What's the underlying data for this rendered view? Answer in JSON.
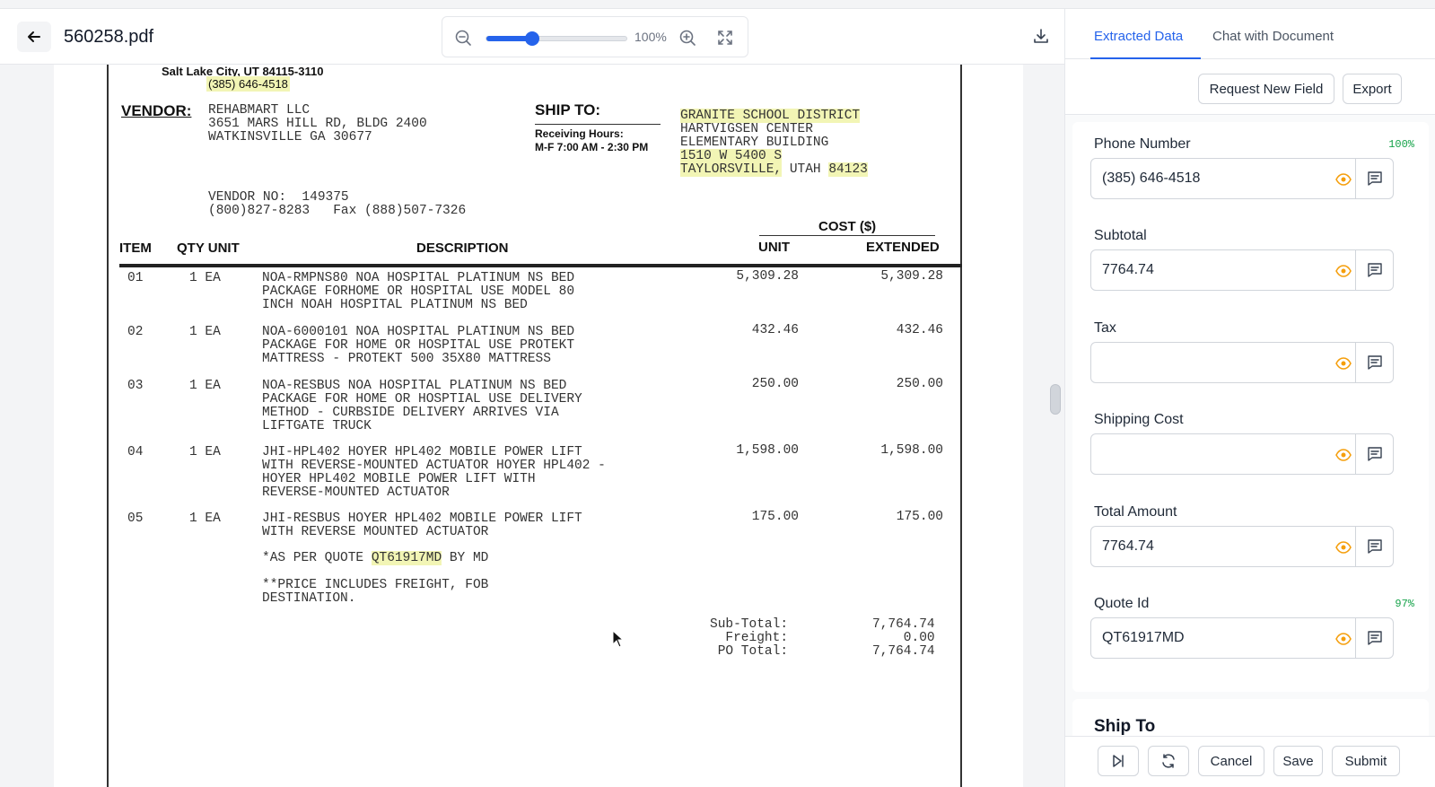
{
  "viewer": {
    "file_name": "560258.pdf",
    "zoom_level": "100%",
    "zoom_fraction": 0.33
  },
  "document": {
    "top_address": "Salt Lake City, UT  84115-3110",
    "top_phone": "(385) 646-4518",
    "vendor_label": "VENDOR:",
    "vendor_lines": [
      "REHABMART LLC",
      "3651 MARS HILL RD, BLDG 2400",
      "WATKINSVILLE GA 30677"
    ],
    "ship_to_label": "SHIP TO:",
    "receiving_label": "Receiving Hours:",
    "receiving_hours": "M-F 7:00 AM - 2:30 PM",
    "ship_lines": [
      "GRANITE SCHOOL DISTRICT",
      "HARTVIGSEN CENTER",
      "ELEMENTARY BUILDING",
      "1510 W 5400 S",
      "TAYLORSVILLE,",
      "UTAH",
      "84123"
    ],
    "vendor_no_line": "VENDOR NO:  149375",
    "vendor_phone_line": "(800)827-8283   Fax (888)507-7326",
    "headers": {
      "cost": "COST ($)",
      "item": "ITEM",
      "qty_unit": "QTY UNIT",
      "description": "DESCRIPTION",
      "unit": "UNIT",
      "extended": "EXTENDED"
    },
    "rows": [
      {
        "item": "01",
        "qty": "1 EA",
        "desc": "NOA-RMPNS80 NOA HOSPITAL PLATINUM NS BED\nPACKAGE FORHOME OR HOSPITAL USE MODEL 80\nINCH NOAH HOSPITAL PLATINUM NS BED",
        "unit": "5,309.28",
        "extended": "5,309.28"
      },
      {
        "item": "02",
        "qty": "1 EA",
        "desc": "NOA-6000101 NOA HOSPITAL PLATINUM NS BED\nPACKAGE FOR HOME OR HOSPITAL USE PROTEKT\nMATTRESS - PROTEKT 500 35X80 MATTRESS",
        "unit": "432.46",
        "extended": "432.46"
      },
      {
        "item": "03",
        "qty": "1 EA",
        "desc": "NOA-RESBUS NOA HOSPITAL PLATINUM NS BED\nPACKAGE FOR HOME OR HOSPTIAL USE DELIVERY\nMETHOD - CURBSIDE DELIVERY ARRIVES VIA\nLIFTGATE TRUCK",
        "unit": "250.00",
        "extended": "250.00"
      },
      {
        "item": "04",
        "qty": "1 EA",
        "desc": "JHI-HPL402 HOYER HPL402 MOBILE POWER LIFT\nWITH REVERSE-MOUNTED ACTUATOR HOYER HPL402 -\nHOYER HPL402 MOBILE POWER LIFT WITH\nREVERSE-MOUNTED ACTUATOR",
        "unit": "1,598.00",
        "extended": "1,598.00"
      },
      {
        "item": "05",
        "qty": "1 EA",
        "desc": "JHI-RESBUS HOYER HPL402 MOBILE POWER LIFT\nWITH REVERSE MOUNTED ACTUATOR",
        "unit": "175.00",
        "extended": "175.00"
      }
    ],
    "quote_prefix": "*AS PER QUOTE",
    "quote_id": "QT61917MD",
    "quote_suffix": "BY MD",
    "freight_note": "**PRICE INCLUDES FREIGHT, FOB\nDESTINATION.",
    "totals_labels": "Sub-Total:\n  Freight:\n PO Total:",
    "totals_values": "7,764.74\n    0.00\n7,764.74"
  },
  "panel": {
    "tabs": [
      "Extracted Data",
      "Chat with Document"
    ],
    "actions": {
      "request_new_field": "Request New Field",
      "export": "Export"
    },
    "fields": [
      {
        "label": "Phone Number",
        "value": "(385) 646-4518",
        "confidence": "100%"
      },
      {
        "label": "Subtotal",
        "value": "7764.74",
        "confidence": ""
      },
      {
        "label": "Tax",
        "value": "",
        "confidence": ""
      },
      {
        "label": "Shipping Cost",
        "value": "",
        "confidence": ""
      },
      {
        "label": "Total Amount",
        "value": "7764.74",
        "confidence": ""
      },
      {
        "label": "Quote Id",
        "value": "QT61917MD",
        "confidence": "97%"
      }
    ],
    "section_title": "Ship To",
    "footer": {
      "cancel": "Cancel",
      "save": "Save",
      "submit": "Submit"
    }
  },
  "colors": {
    "accent": "#2563eb",
    "highlight": "#f2f5b5",
    "confidence": "#16a34a",
    "eye_icon": "#f59e0b"
  },
  "icons": [
    "arrow-left-icon",
    "zoom-out-icon",
    "zoom-in-icon",
    "fullscreen-icon",
    "download-icon",
    "eye-icon",
    "note-icon",
    "skip-next-icon",
    "refresh-icon"
  ]
}
